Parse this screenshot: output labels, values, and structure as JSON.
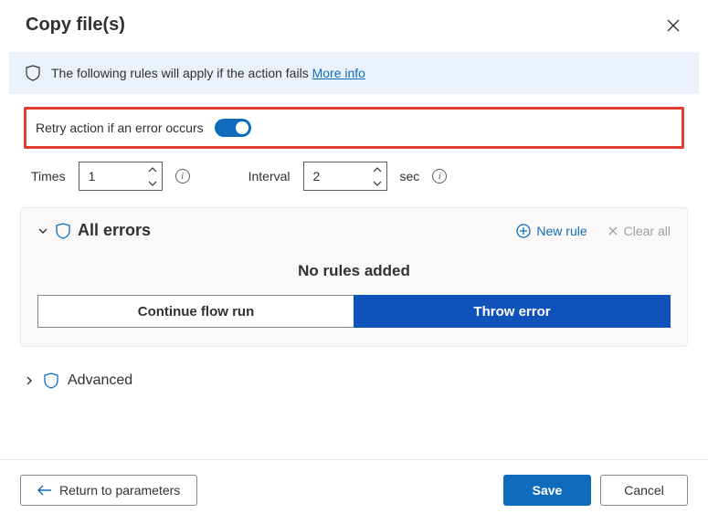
{
  "dialog": {
    "title": "Copy file(s)"
  },
  "banner": {
    "text": "The following rules will apply if the action fails",
    "more_info_label": "More info"
  },
  "retry": {
    "label": "Retry action if an error occurs",
    "enabled": true
  },
  "times": {
    "label": "Times",
    "value": "1"
  },
  "interval": {
    "label": "Interval",
    "value": "2",
    "unit": "sec"
  },
  "errors_panel": {
    "title": "All errors",
    "new_rule_label": "New rule",
    "clear_all_label": "Clear all",
    "empty_message": "No rules added",
    "continue_label": "Continue flow run",
    "throw_label": "Throw error"
  },
  "advanced": {
    "label": "Advanced"
  },
  "footer": {
    "return_label": "Return to parameters",
    "save_label": "Save",
    "cancel_label": "Cancel"
  }
}
